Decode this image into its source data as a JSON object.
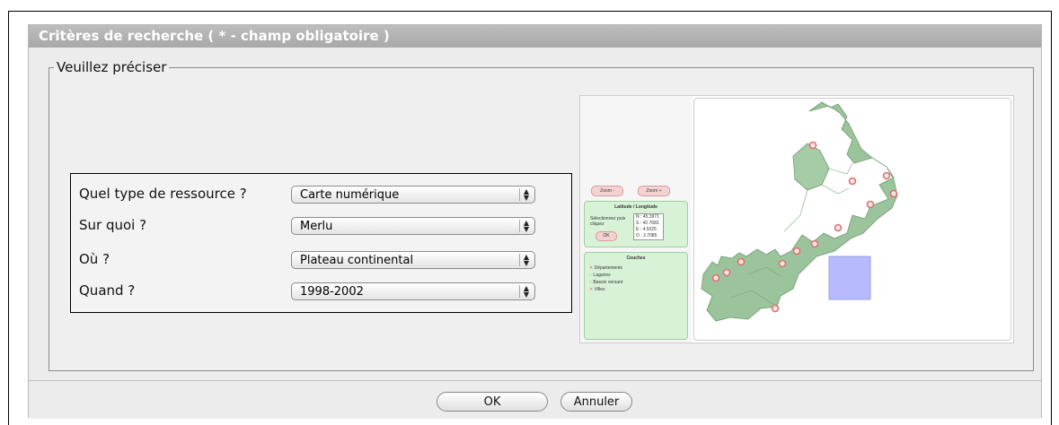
{
  "panel": {
    "title": "Critères de recherche ( * - champ obligatoire )",
    "legend": "Veuillez préciser"
  },
  "criteria": [
    {
      "label": "Quel type de ressource ?",
      "value": "Carte numérique"
    },
    {
      "label": "Sur quoi ?",
      "value": "Merlu"
    },
    {
      "label": "Où ?",
      "value": "Plateau continental"
    },
    {
      "label": "Quand ?",
      "value": "1998-2002"
    }
  ],
  "map": {
    "zoom_out": "Zoom -",
    "zoom_in": "Zoom +",
    "latlon_title": "Latitude / Longitude",
    "selection_hint": "Sélectionnez puis cliquez",
    "ok_small": "OK",
    "coords": [
      "N : 45.3971",
      "S : 42.7683",
      "E : 4.5025",
      "O : 3.7085"
    ],
    "layers_title": "Couches",
    "layers": [
      "Départements",
      "Lagunes",
      "Bassin versant",
      "Villes"
    ],
    "colors": {
      "land": "#9cc49c",
      "land_stroke": "#6e9a6e",
      "city": "#f08080",
      "selection": "#b8baff"
    }
  },
  "buttons": {
    "ok": "OK",
    "cancel": "Annuler"
  }
}
